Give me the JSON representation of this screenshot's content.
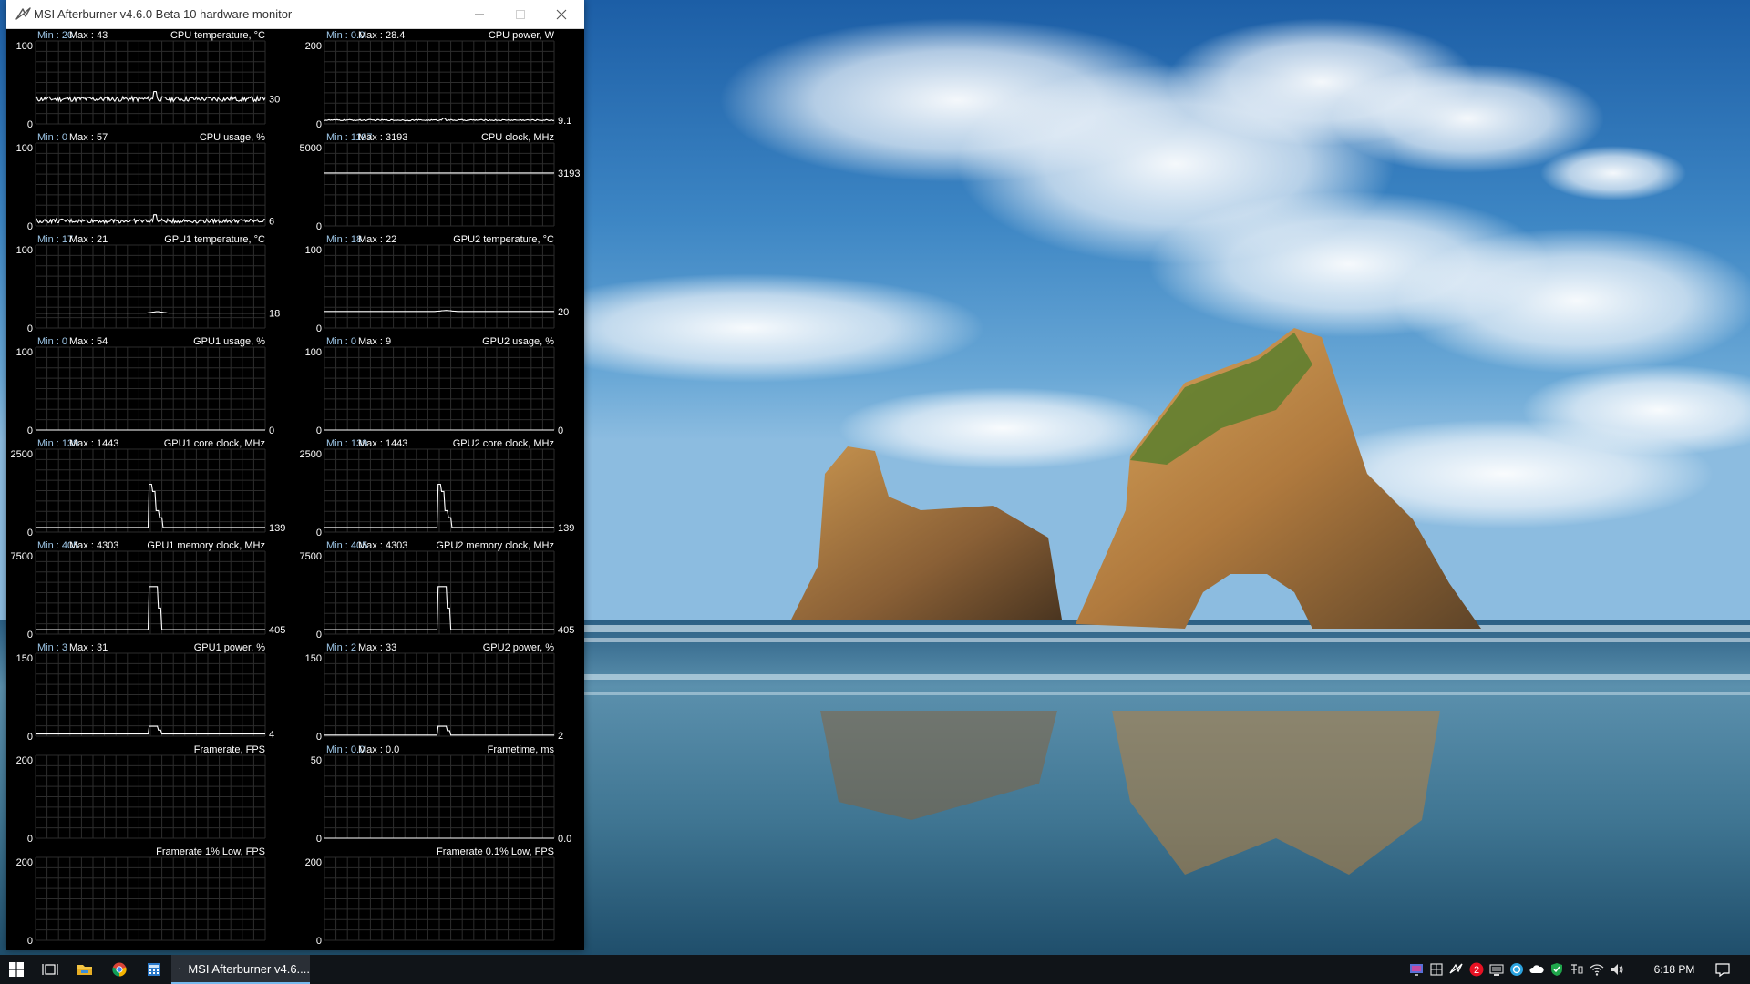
{
  "window": {
    "title": "MSI Afterburner v4.6.0 Beta 10 hardware monitor"
  },
  "graphs": [
    {
      "label": "CPU temperature, °C",
      "min_text": "Min : 20",
      "max_text": "Max : 43",
      "axis_max": "100",
      "axis_min": "0",
      "current": "30",
      "scale": 100,
      "value": 30,
      "shape": "noisy",
      "noise": 3
    },
    {
      "label": "CPU power, W",
      "min_text": "Min : 0.0",
      "max_text": "Max : 28.4",
      "axis_max": "200",
      "axis_min": "0",
      "current": "9.1",
      "scale": 200,
      "value": 9.1,
      "shape": "noisy",
      "noise": 1.5
    },
    {
      "label": "CPU usage, %",
      "min_text": "Min : 0",
      "max_text": "Max : 57",
      "axis_max": "100",
      "axis_min": "0",
      "current": "6",
      "scale": 100,
      "value": 6,
      "shape": "noisy",
      "noise": 2.5
    },
    {
      "label": "CPU clock, MHz",
      "min_text": "Min : 1197",
      "max_text": "Max : 3193",
      "axis_max": "5000",
      "axis_min": "0",
      "current": "3193",
      "scale": 5000,
      "value": 3193,
      "shape": "flat"
    },
    {
      "label": "GPU1 temperature, °C",
      "min_text": "Min : 17",
      "max_text": "Max : 21",
      "axis_max": "100",
      "axis_min": "0",
      "current": "18",
      "scale": 100,
      "value": 18,
      "shape": "bump",
      "peak": 21
    },
    {
      "label": "GPU2 temperature, °C",
      "min_text": "Min : 18",
      "max_text": "Max : 22",
      "axis_max": "100",
      "axis_min": "0",
      "current": "20",
      "scale": 100,
      "value": 20,
      "shape": "bump",
      "peak": 22
    },
    {
      "label": "GPU1 usage, %",
      "min_text": "Min : 0",
      "max_text": "Max : 54",
      "axis_max": "100",
      "axis_min": "0",
      "current": "0",
      "scale": 100,
      "value": 0,
      "shape": "flat"
    },
    {
      "label": "GPU2 usage, %",
      "min_text": "Min : 0",
      "max_text": "Max : 9",
      "axis_max": "100",
      "axis_min": "0",
      "current": "0",
      "scale": 100,
      "value": 0,
      "shape": "flat"
    },
    {
      "label": "GPU1 core clock, MHz",
      "min_text": "Min : 139",
      "max_text": "Max : 1443",
      "axis_max": "2500",
      "axis_min": "0",
      "current": "139",
      "scale": 2500,
      "value": 139,
      "shape": "spike",
      "peak": 1443
    },
    {
      "label": "GPU2 core clock, MHz",
      "min_text": "Min : 139",
      "max_text": "Max : 1443",
      "axis_max": "2500",
      "axis_min": "0",
      "current": "139",
      "scale": 2500,
      "value": 139,
      "shape": "spike",
      "peak": 1443
    },
    {
      "label": "GPU1 memory clock, MHz",
      "min_text": "Min : 405",
      "max_text": "Max : 4303",
      "axis_max": "7500",
      "axis_min": "0",
      "current": "405",
      "scale": 7500,
      "value": 405,
      "shape": "pulse",
      "peak": 4303
    },
    {
      "label": "GPU2 memory clock, MHz",
      "min_text": "Min : 405",
      "max_text": "Max : 4303",
      "axis_max": "7500",
      "axis_min": "0",
      "current": "405",
      "scale": 7500,
      "value": 405,
      "shape": "pulse",
      "peak": 4303
    },
    {
      "label": "GPU1 power, %",
      "min_text": "Min : 3",
      "max_text": "Max : 31",
      "axis_max": "150",
      "axis_min": "0",
      "current": "4",
      "scale": 150,
      "value": 4,
      "shape": "pulse",
      "peak": 18
    },
    {
      "label": "GPU2 power, %",
      "min_text": "Min : 2",
      "max_text": "Max : 33",
      "axis_max": "150",
      "axis_min": "0",
      "current": "2",
      "scale": 150,
      "value": 2,
      "shape": "pulse",
      "peak": 18
    },
    {
      "label": "Framerate, FPS",
      "min_text": "",
      "max_text": "",
      "axis_max": "200",
      "axis_min": "0",
      "current": "",
      "scale": 200,
      "value": null,
      "shape": "none"
    },
    {
      "label": "Frametime, ms",
      "min_text": "Min : 0.0",
      "max_text": "Max : 0.0",
      "axis_max": "50",
      "axis_min": "0",
      "current": "0.0",
      "scale": 50,
      "value": 0,
      "shape": "flat"
    },
    {
      "label": "Framerate 1% Low, FPS",
      "min_text": "",
      "max_text": "",
      "axis_max": "200",
      "axis_min": "0",
      "current": "",
      "scale": 200,
      "value": null,
      "shape": "none"
    },
    {
      "label": "Framerate 0.1% Low, FPS",
      "min_text": "",
      "max_text": "",
      "axis_max": "200",
      "axis_min": "0",
      "current": "",
      "scale": 200,
      "value": null,
      "shape": "none"
    }
  ],
  "taskbar": {
    "active_task_label": "MSI Afterburner v4.6....",
    "clock": "6:18 PM",
    "notification_badge": "2"
  },
  "colors": {
    "graph_background": "#000000",
    "grid": "#2c2c2c",
    "line": "#ffffff",
    "label_text": "#ffffff",
    "minmax_text": "#9ec7e8",
    "taskbar": "#101418",
    "accent": "#76b9ed",
    "badge": "#e81123"
  },
  "icons": {
    "app": "afterburner-icon",
    "minimize": "minimize-icon",
    "maximize": "maximize-icon",
    "close": "close-icon",
    "start": "windows-logo-icon",
    "task_view": "task-view-icon",
    "explorer": "folder-icon",
    "chrome": "chrome-icon",
    "calculator": "calculator-icon",
    "action_center": "notification-icon"
  }
}
